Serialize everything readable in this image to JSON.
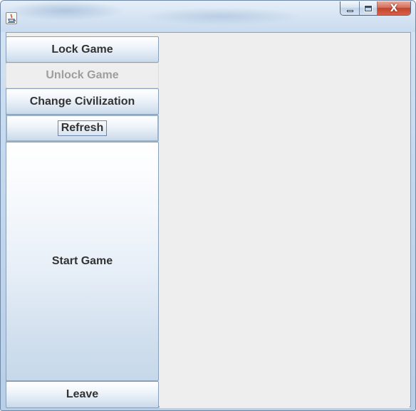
{
  "window": {
    "title": "",
    "app_icon": "java-cup-icon",
    "caption_buttons": {
      "minimize_icon": "minimize-icon",
      "maximize_icon": "maximize-icon",
      "close_glyph": "X"
    },
    "accent_close": "#c2442b"
  },
  "sidebar": {
    "lock_game": "Lock Game",
    "unlock_game": "Unlock Game",
    "change_civilization": "Change Civilization",
    "refresh": "Refresh",
    "start_game": "Start Game",
    "leave": "Leave"
  },
  "states": {
    "unlock_game_enabled": false,
    "refresh_focused": true
  }
}
